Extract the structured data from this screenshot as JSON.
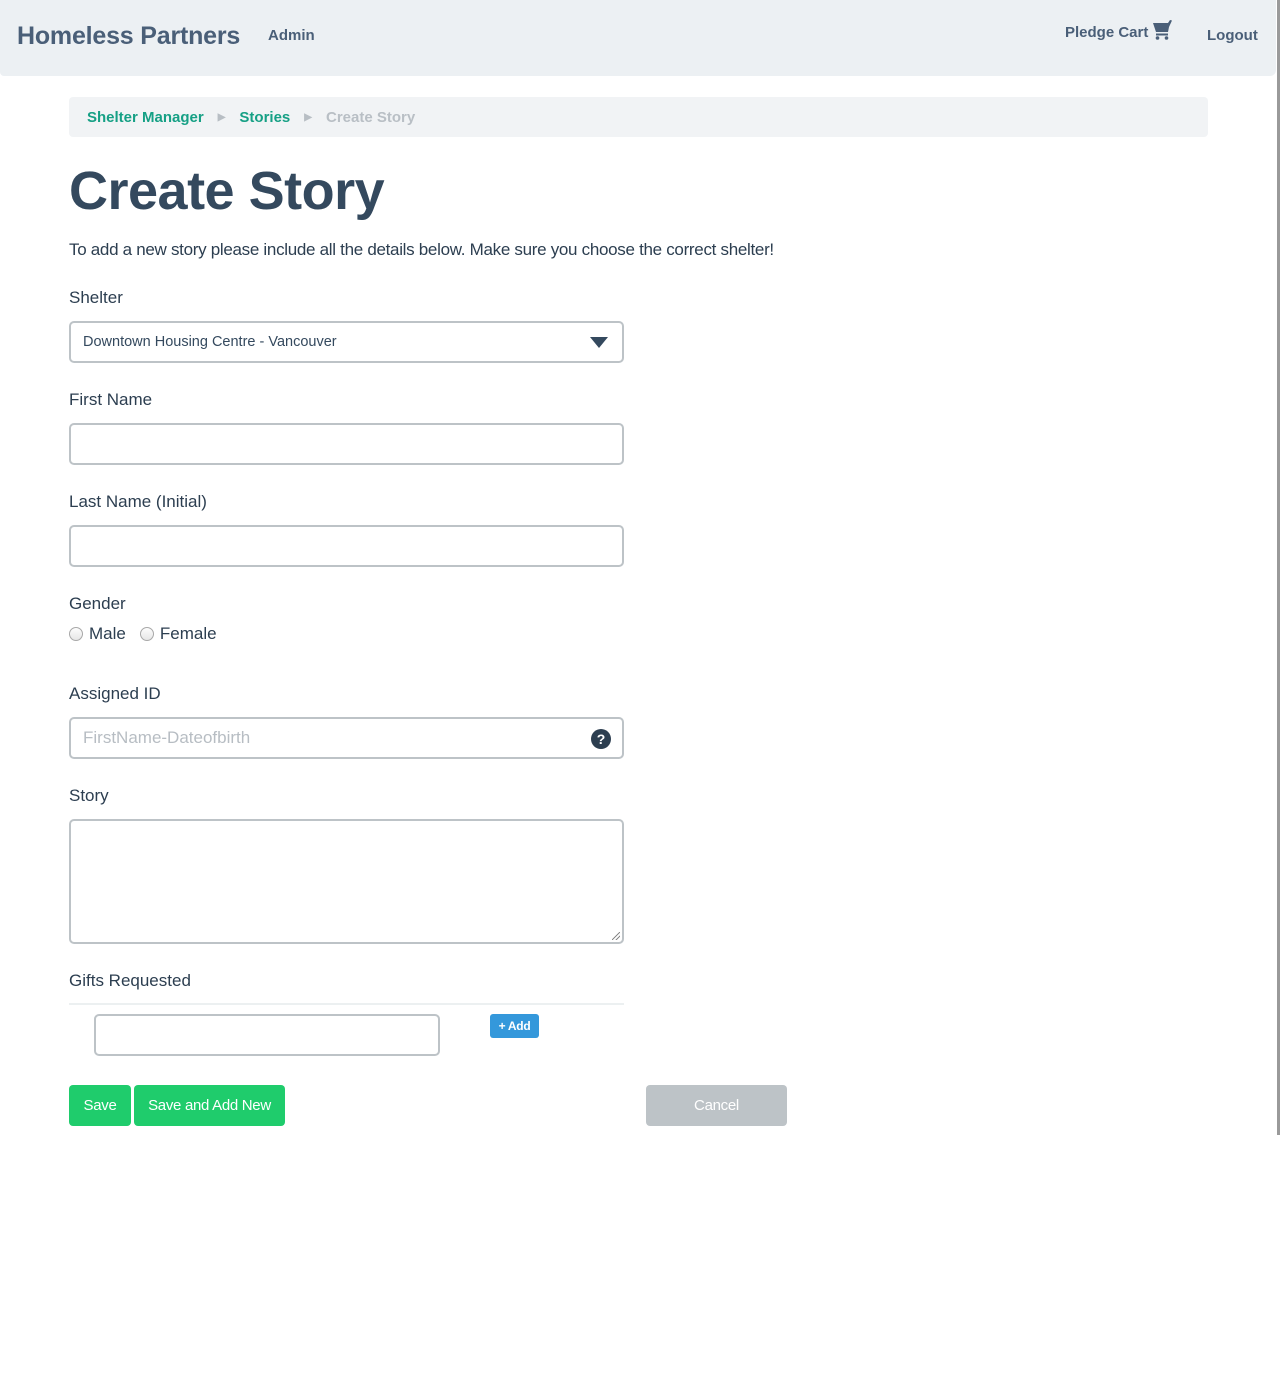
{
  "navbar": {
    "brand": "Homeless Partners",
    "admin_label": "Admin",
    "cart_label": "Pledge Cart",
    "cart_icon": "shopping-cart-icon",
    "logout_label": "Logout"
  },
  "breadcrumb": {
    "items": [
      {
        "label": "Shelter Manager",
        "link": true
      },
      {
        "label": "Stories",
        "link": true
      },
      {
        "label": "Create Story",
        "link": false
      }
    ],
    "separator": "▶"
  },
  "page": {
    "title": "Create Story",
    "intro": "To add a new story please include all the details below. Make sure you choose the correct shelter!"
  },
  "form": {
    "shelter": {
      "label": "Shelter",
      "selected": "Downtown Housing Centre - Vancouver"
    },
    "first_name": {
      "label": "First Name",
      "value": ""
    },
    "last_name": {
      "label": "Last Name (Initial)",
      "value": ""
    },
    "gender": {
      "label": "Gender",
      "options": [
        "Male",
        "Female"
      ],
      "selected": null
    },
    "assigned_id": {
      "label": "Assigned ID",
      "placeholder": "FirstName-Dateofbirth",
      "help_icon": "?"
    },
    "story": {
      "label": "Story",
      "value": ""
    },
    "gifts": {
      "label": "Gifts Requested",
      "value": "",
      "add_label": "+ Add"
    }
  },
  "actions": {
    "save_label": "Save",
    "save_new_label": "Save and Add New",
    "cancel_label": "Cancel"
  },
  "colors": {
    "brand_text": "#4a5f78",
    "link_green": "#16a085",
    "primary_green": "#1fcc6c",
    "add_blue": "#3498db",
    "cancel_gray": "#bdc3c7",
    "heading": "#34495e"
  }
}
